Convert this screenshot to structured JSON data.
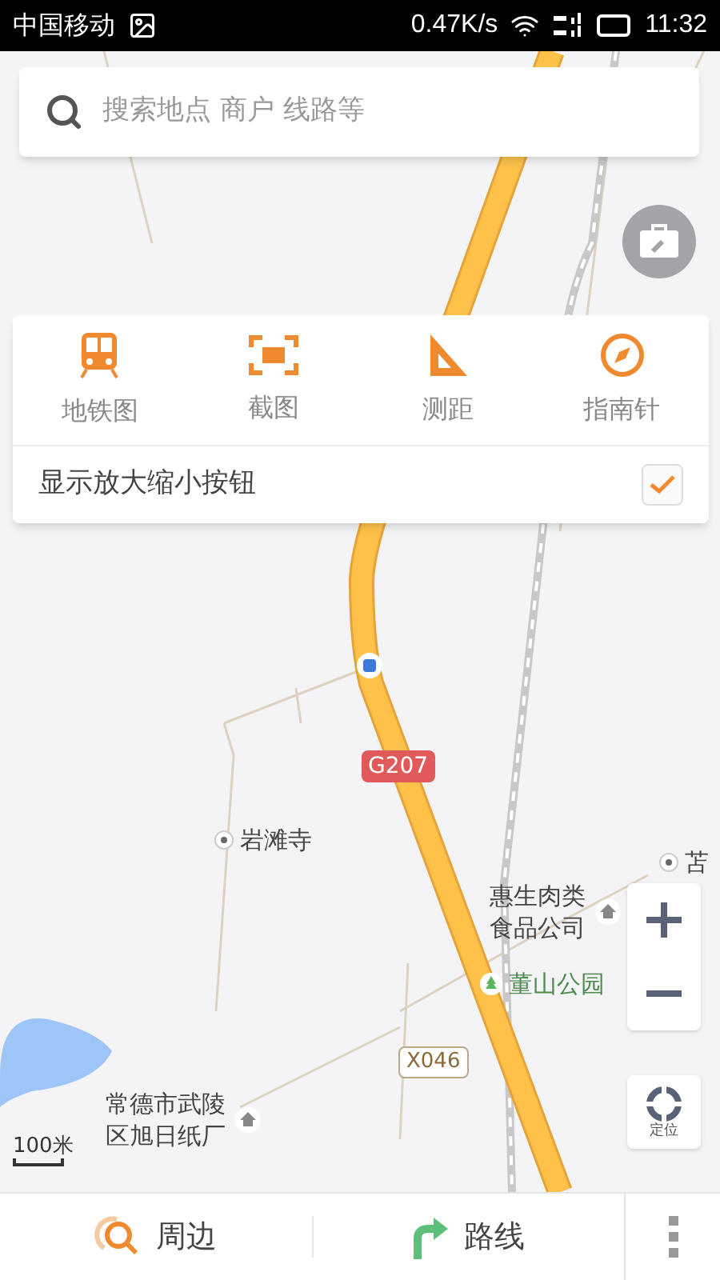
{
  "status_bar": {
    "carrier": "中国移动",
    "speed": "0.47K/s",
    "time": "11:32"
  },
  "search": {
    "placeholder": "搜索地点 商户 线路等"
  },
  "tools_panel": {
    "items": [
      {
        "label": "地铁图",
        "kind": "metro"
      },
      {
        "label": "截图",
        "kind": "screenshot"
      },
      {
        "label": "测距",
        "kind": "ruler"
      },
      {
        "label": "指南针",
        "kind": "compass"
      }
    ],
    "option": {
      "label": "显示放大缩小按钮",
      "checked": true
    }
  },
  "map_labels": [
    {
      "text": "G207",
      "kind": "national_road"
    },
    {
      "text": "岩滩寺",
      "kind": "poi"
    },
    {
      "text": "惠生肉类食品公司",
      "kind": "company"
    },
    {
      "text": "苫",
      "kind": "poi"
    },
    {
      "text": "董山公园",
      "kind": "park"
    },
    {
      "text": "X046",
      "kind": "county_road"
    },
    {
      "text": "常德市武陵区旭日纸厂",
      "kind": "company"
    }
  ],
  "scale": "100米",
  "locate_button": {
    "label": "定位"
  },
  "bottom_bar": [
    {
      "label": "周边",
      "kind": "nearby"
    },
    {
      "label": "路线",
      "kind": "route"
    }
  ]
}
